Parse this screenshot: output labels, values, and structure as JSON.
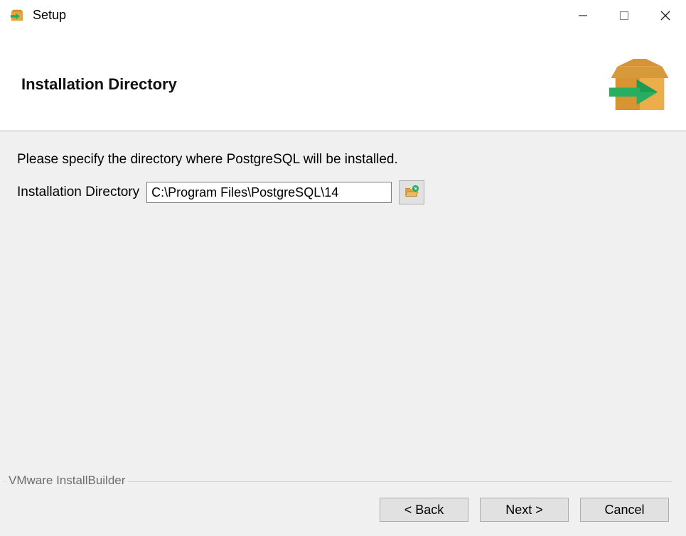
{
  "window": {
    "title": "Setup"
  },
  "header": {
    "heading": "Installation Directory"
  },
  "content": {
    "instruction": "Please specify the directory where PostgreSQL will be installed.",
    "field_label": "Installation Directory",
    "field_value": "C:\\Program Files\\PostgreSQL\\14"
  },
  "footer": {
    "branding": "VMware InstallBuilder",
    "back_label": "< Back",
    "next_label": "Next >",
    "cancel_label": "Cancel"
  }
}
